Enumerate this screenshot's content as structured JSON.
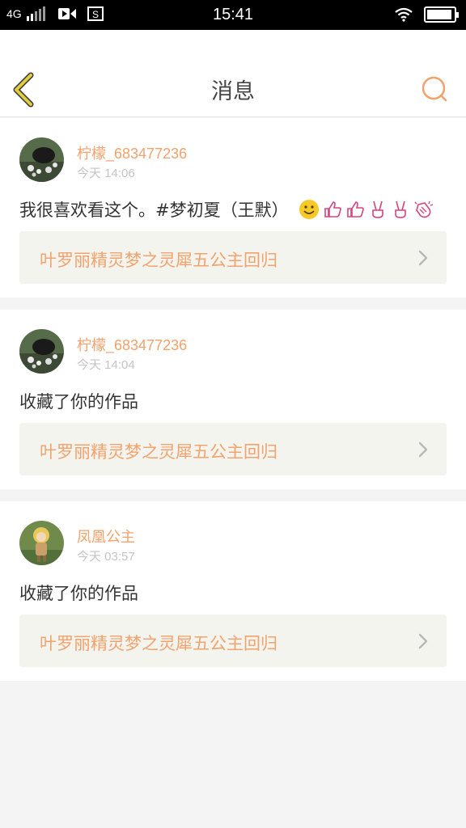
{
  "status_bar": {
    "network": "4G",
    "time": "15:41",
    "icons": [
      "signal-icon",
      "video-icon",
      "screenshot-icon",
      "wifi-icon",
      "battery-icon"
    ],
    "battery_level": 0.95
  },
  "header": {
    "title": "消息",
    "back_icon": "chevron-left-icon",
    "search_icon": "search-icon"
  },
  "colors": {
    "accent": "#f2a26c",
    "back_icon": "#c8b400",
    "link_bg": "#f4f4ef",
    "page_bg": "#f4f4f4"
  },
  "notifications": [
    {
      "username": "柠檬_683477236",
      "time": "今天 14:06",
      "message": "我很喜欢看这个。#梦初夏（王默）",
      "emojis": [
        "smile-emoji",
        "thumbs-up-emoji",
        "thumbs-up-emoji",
        "victory-hand-emoji",
        "victory-hand-emoji",
        "clapping-hands-emoji"
      ],
      "link": "叶罗丽精灵梦之灵犀五公主回归"
    },
    {
      "username": "柠檬_683477236",
      "time": "今天 14:04",
      "message": "收藏了你的作品",
      "link": "叶罗丽精灵梦之灵犀五公主回归"
    },
    {
      "username": "凤凰公主",
      "time": "今天 03:57",
      "message": "收藏了你的作品",
      "link": "叶罗丽精灵梦之灵犀五公主回归"
    }
  ]
}
